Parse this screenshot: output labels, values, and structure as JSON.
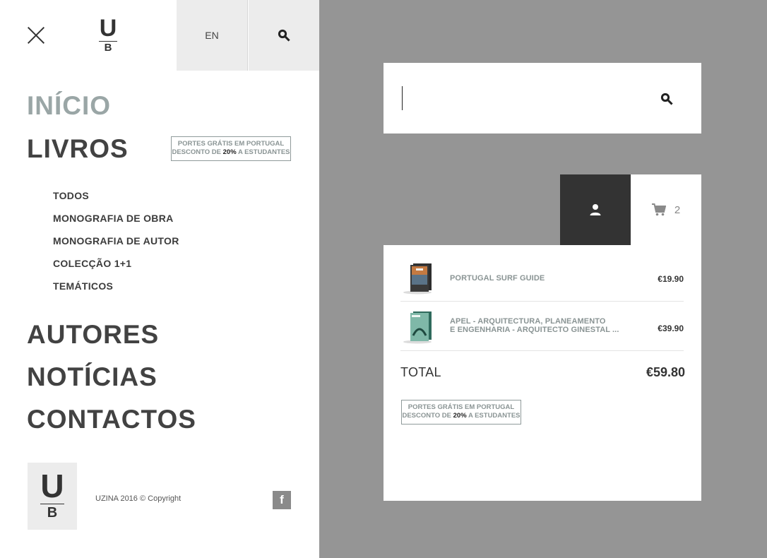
{
  "menu": {
    "language": "EN",
    "logo": {
      "top": "U",
      "bottom": "B"
    },
    "nav": [
      {
        "label": "INÍCIO",
        "active": true
      },
      {
        "label": "LIVROS",
        "active": false
      },
      {
        "label": "AUTORES",
        "active": false
      },
      {
        "label": "NOTÍCIAS",
        "active": false
      },
      {
        "label": "CONTACTOS",
        "active": false
      }
    ],
    "books_sub": [
      "TODOS",
      "MONOGRAFIA DE OBRA",
      "MONOGRAFIA DE AUTOR",
      "COLECÇÃO 1+1",
      "TEMÁTICOS"
    ],
    "promo": {
      "line1": "PORTES GRÁTIS EM PORTUGAL",
      "line2_pre": "DESCONTO DE",
      "line2_bold": "20%",
      "line2_post": "A ESTUDANTES"
    },
    "footer": {
      "copyright": "UZINA 2016 © Copyright",
      "social": "f"
    }
  },
  "search": {
    "value": "",
    "placeholder": ""
  },
  "account": {
    "user_icon": "user-icon",
    "cart_icon": "cart-icon",
    "cart_count": "2"
  },
  "cart": {
    "items": [
      {
        "title_line1": "PORTUGAL SURF GUIDE",
        "title_line2": "",
        "price": "€19.90"
      },
      {
        "title_line1": "APEL - ARQUITECTURA, PLANEAMENTO",
        "title_line2": "E ENGENHARIA - ARQUITECTO GINESTAL ...",
        "price": "€39.90"
      }
    ],
    "total_label": "TOTAL",
    "total_value": "€59.80"
  },
  "colors": {
    "overlay": "#959595",
    "active_nav": "#9aa6a6",
    "text": "#424242",
    "user_tab": "#333333"
  }
}
